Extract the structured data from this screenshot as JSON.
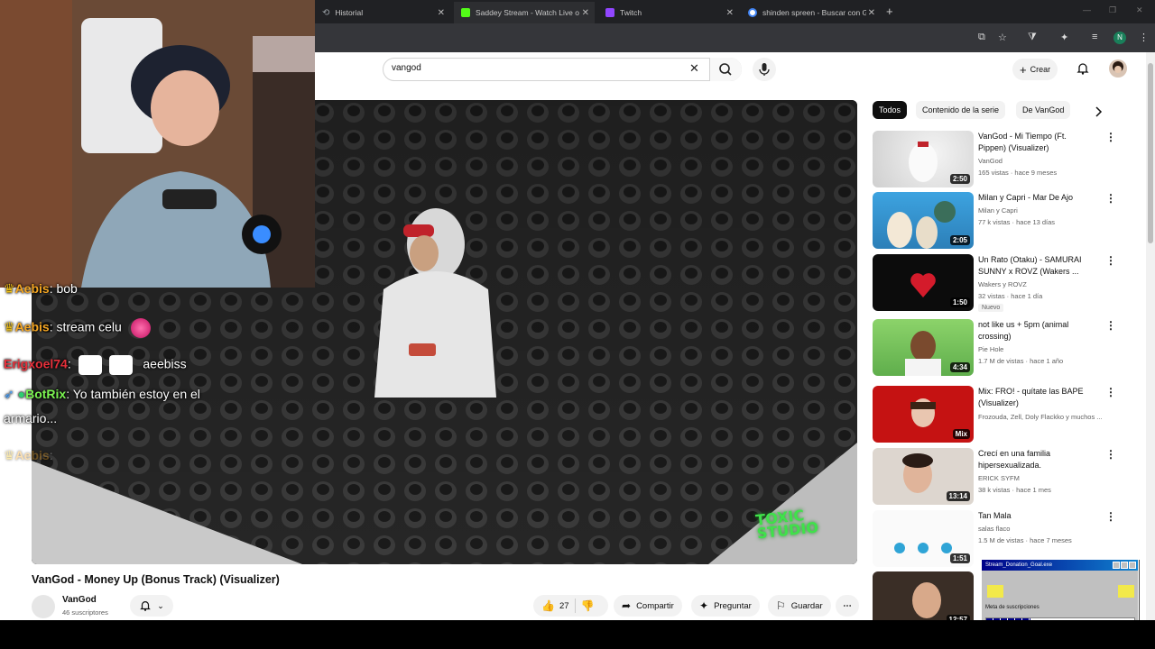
{
  "browser": {
    "tabs": [
      {
        "title": "Historial",
        "icon": "history-icon",
        "color": "#9aa0a6"
      },
      {
        "title": "Saddey Stream - Watch Live on",
        "icon": "kick-icon",
        "color": "#53fc18"
      },
      {
        "title": "Twitch",
        "icon": "twitch-icon",
        "color": "#9146ff"
      },
      {
        "title": "shinden spreen - Buscar con Go",
        "icon": "google-icon",
        "color": "#4285f4"
      }
    ],
    "profile_initial": "N"
  },
  "youtube": {
    "search_value": "vangod",
    "create_label": "Crear",
    "video": {
      "title": "VanGod - Money Up (Bonus Track) (Visualizer)",
      "channel": "VanGod",
      "subscribers": "46 suscriptores",
      "likes": "27",
      "share_label": "Compartir",
      "ask_label": "Preguntar",
      "save_label": "Guardar",
      "watermark_line1": "TOXIC",
      "watermark_line2": "STUDIO"
    },
    "chips": [
      "Todos",
      "Contenido de la serie",
      "De VanGod"
    ],
    "recommendations": [
      {
        "title": "VanGod - Mi Tiempo (Ft. Pippen) (Visualizer)",
        "channel": "VanGod",
        "meta": "165 vistas · hace 9 meses",
        "duration": "2:50"
      },
      {
        "title": "Milan y Capri - Mar De Ajo",
        "channel": "Milan y Capri",
        "meta": "77 k vistas · hace 13 días",
        "duration": "2:05"
      },
      {
        "title": "Un Rato (Otaku) - SAMURAI SUNNY x ROVZ (Wakers ...",
        "channel": "Wakers y ROVZ",
        "meta": "32 vistas · hace 1 día",
        "duration": "1:50",
        "badge": "Nuevo"
      },
      {
        "title": "not like us + 5pm (animal crossing)",
        "channel": "Pie Hole",
        "meta": "1.7 M de vistas · hace 1 año",
        "duration": "4:34"
      },
      {
        "title": "Mix: FRO! - quítate las BAPE (Visualizer)",
        "channel": "Frozouda, Zell, Doly Flackko y muchos ...",
        "meta": "",
        "duration": "Mix"
      },
      {
        "title": "Crecí en una familia hipersexualizada.",
        "channel": "ERICK SYFM",
        "meta": "38 k vistas · hace 1 mes",
        "duration": "13:14"
      },
      {
        "title": "Tan Mala",
        "channel": "salas flaco",
        "meta": "1.5 M de vistas · hace 7 meses",
        "duration": "1:51"
      },
      {
        "title": "",
        "channel": "",
        "meta": "",
        "duration": "12:57"
      }
    ]
  },
  "chat": [
    {
      "user": "Aebis",
      "text": "bob",
      "color": "#f5a623"
    },
    {
      "user": "Aebis",
      "text": "stream celu",
      "color": "#f5a623"
    },
    {
      "user": "Erigxoel74",
      "text": "aeebiss",
      "color": "#e8303b"
    },
    {
      "user": "BotRix",
      "text": "Yo también estoy en el",
      "text2": "armario...",
      "color": "#7cf552"
    },
    {
      "user": "Aebis",
      "text": "",
      "color": "#f5a623"
    }
  ],
  "goal_widget": {
    "title": "Stream_Donation_Goal.exe",
    "label": "Meta de suscripciones",
    "progress": 0.3
  }
}
